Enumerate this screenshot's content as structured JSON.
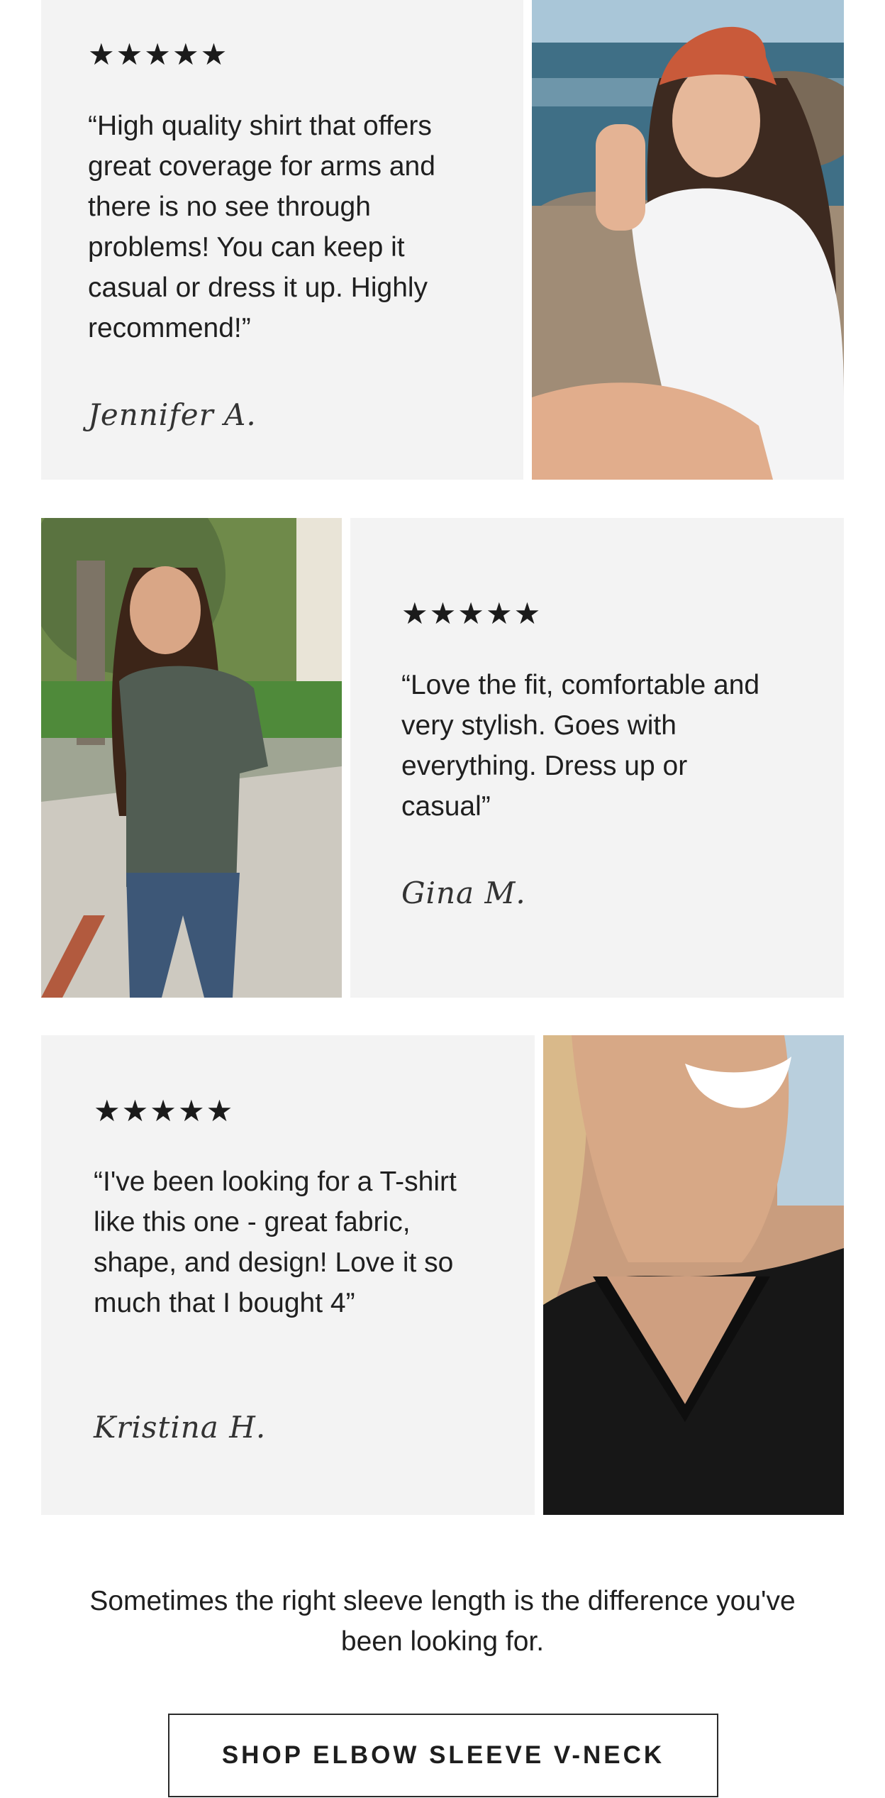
{
  "reviews": [
    {
      "stars": "★★★★★",
      "quote": "“High quality shirt that offers great coverage for arms and there is no see through problems! You can keep it casual or dress it up. Highly recommend!”",
      "signature": "Jennifer A."
    },
    {
      "stars": "★★★★★",
      "quote": "“Love the fit, comfortable and very stylish. Goes with everything. Dress up or casual”",
      "signature": "Gina M."
    },
    {
      "stars": "★★★★★",
      "quote": "“I've been looking for a T-shirt like this one - great fabric, shape, and design! Love it so much that I bought 4”",
      "signature": "Kristina H."
    }
  ],
  "tagline": "Sometimes the right sleeve length is the difference you've been looking for.",
  "cta_label": "SHOP ELBOW SLEEVE V-NECK",
  "colors": {
    "panel": "#f3f3f3",
    "text": "#1e1e1e",
    "border": "#2a2a2a"
  }
}
